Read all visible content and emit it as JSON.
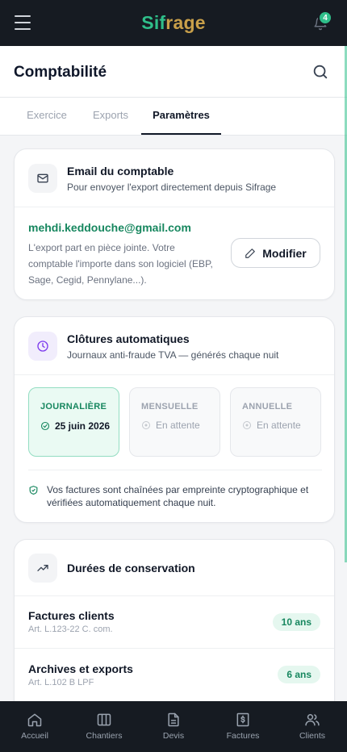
{
  "app": {
    "logo_part1": "Sif",
    "logo_part2": "rage",
    "notifications_count": "4"
  },
  "header": {
    "title": "Comptabilité"
  },
  "tabs": [
    {
      "label": "Exercice",
      "active": false
    },
    {
      "label": "Exports",
      "active": false
    },
    {
      "label": "Paramètres",
      "active": true
    }
  ],
  "email_card": {
    "title": "Email du comptable",
    "subtitle": "Pour envoyer l'export directement depuis Sifrage",
    "email": "mehdi.keddouche@gmail.com",
    "description": "L'export part en pièce jointe. Votre comptable l'importe dans son logiciel (EBP, Sage, Cegid, Pennylane...).",
    "modify_label": "Modifier"
  },
  "closures_card": {
    "title": "Clôtures automatiques",
    "subtitle": "Journaux anti-fraude TVA — générés chaque nuit",
    "periods": [
      {
        "label": "JOURNALIÈRE",
        "status": "25 juin 2026",
        "active": true
      },
      {
        "label": "MENSUELLE",
        "status": "En attente",
        "active": false
      },
      {
        "label": "ANNUELLE",
        "status": "En attente",
        "active": false
      }
    ],
    "note": "Vos factures sont chaînées par empreinte cryptographique et vérifiées automatiquement chaque nuit."
  },
  "retention_card": {
    "title": "Durées de conservation",
    "rows": [
      {
        "title": "Factures clients",
        "subtitle": "Art. L.123-22 C. com.",
        "duration": "10 ans"
      },
      {
        "title": "Archives et exports",
        "subtitle": "Art. L.102 B LPF",
        "duration": "6 ans"
      }
    ]
  },
  "bottom_nav": [
    {
      "label": "Accueil",
      "icon": "home-icon"
    },
    {
      "label": "Chantiers",
      "icon": "columns-icon"
    },
    {
      "label": "Devis",
      "icon": "document-icon"
    },
    {
      "label": "Factures",
      "icon": "invoice-icon"
    },
    {
      "label": "Clients",
      "icon": "users-icon"
    }
  ],
  "colors": {
    "accent": "#2fbf8a",
    "accent_dark": "#17875f",
    "gold": "#c9a04a",
    "dark": "#161b22"
  }
}
